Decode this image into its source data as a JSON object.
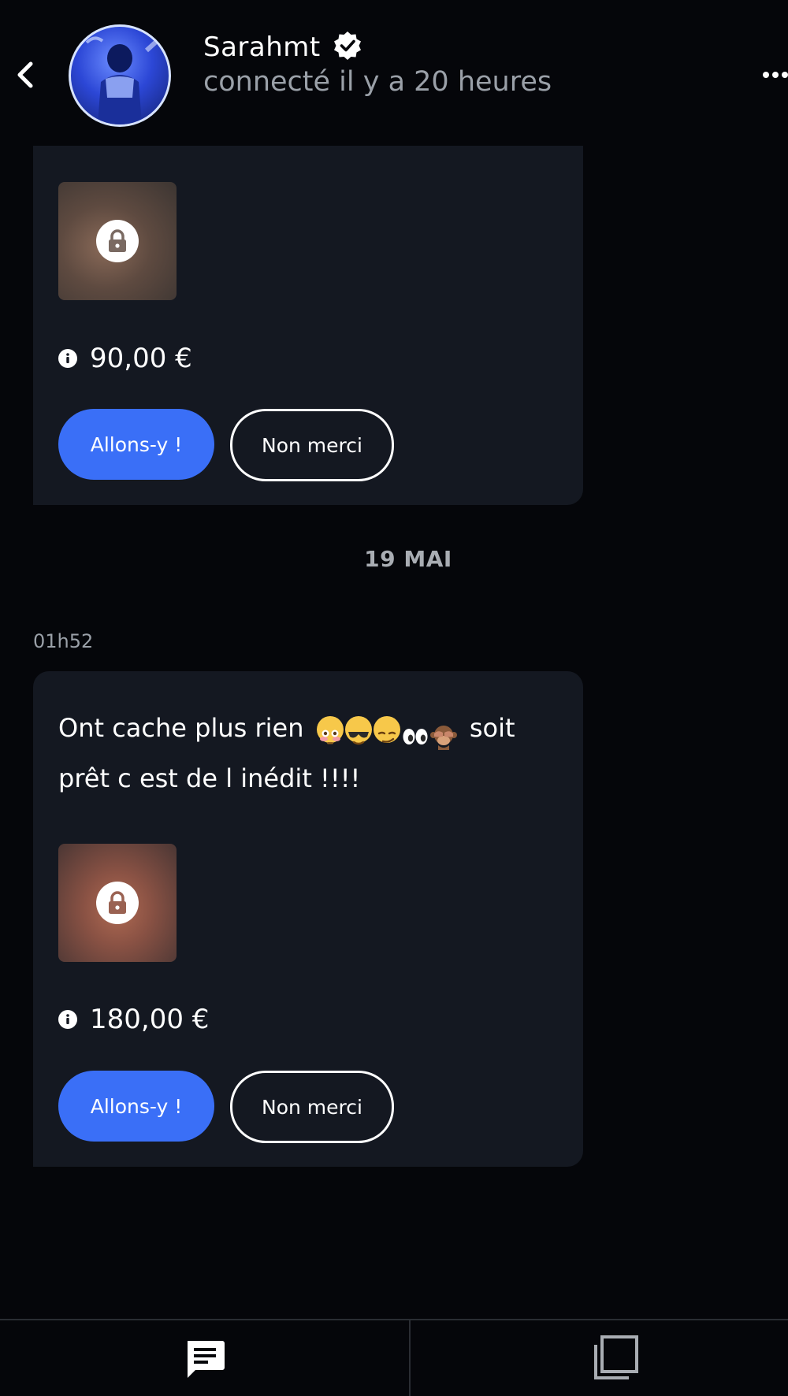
{
  "header": {
    "name": "Sarahmt",
    "status": "connecté il y a 20 heures",
    "back_icon": "chevron-left-icon",
    "verified_icon": "verified-badge-icon",
    "more_icon": "more-options-icon"
  },
  "messages": [
    {
      "locked": true,
      "price": "90,00 €",
      "accept_label": "Allons-y !",
      "decline_label": "Non merci"
    },
    {
      "time": "01h52",
      "text_before_emoji": "Ont cache plus rien",
      "emojis": [
        "flushed-face",
        "sunglasses-face",
        "smirk-face",
        "eyes",
        "see-no-evil-monkey"
      ],
      "text_after_emoji": "soit prêt c est de l inédit !!!!",
      "locked": true,
      "price": "180,00 €",
      "accept_label": "Allons-y !",
      "decline_label": "Non merci"
    }
  ],
  "date_separator": "19 MAI",
  "bottom_nav": {
    "left_icon": "chat-bubble-icon",
    "right_icon": "gallery-icon"
  },
  "colors": {
    "background": "#05060a",
    "card": "#141821",
    "accent": "#3a6ff7",
    "muted_text": "#9aa0a8"
  }
}
